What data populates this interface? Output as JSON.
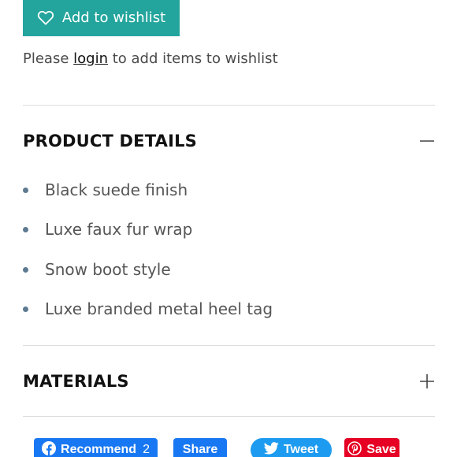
{
  "wishlist": {
    "button_label": "Add to wishlist",
    "prompt_before": "Please ",
    "login_link": "login",
    "prompt_after": " to add items to wishlist"
  },
  "product_details": {
    "title": "PRODUCT DETAILS",
    "expanded": true,
    "items": [
      "Black suede finish",
      "Luxe faux fur wrap",
      "Snow boot style",
      "Luxe branded metal heel tag"
    ]
  },
  "materials": {
    "title": "MATERIALS",
    "expanded": false
  },
  "social": {
    "recommend_label": "Recommend",
    "recommend_count": "2",
    "share_label": "Share",
    "tweet_label": "Tweet",
    "save_label": "Save"
  },
  "colors": {
    "accent": "#23a59d",
    "facebook": "#1877f2",
    "twitter": "#1d9bf0",
    "pinterest": "#e60023",
    "bullet": "#5d7a91"
  },
  "icons": {
    "wishlist": "heart-outline-icon",
    "details_toggle": "minus-icon",
    "materials_toggle": "plus-icon",
    "facebook": "facebook-icon",
    "twitter": "twitter-bird-icon",
    "pinterest": "pinterest-icon"
  }
}
